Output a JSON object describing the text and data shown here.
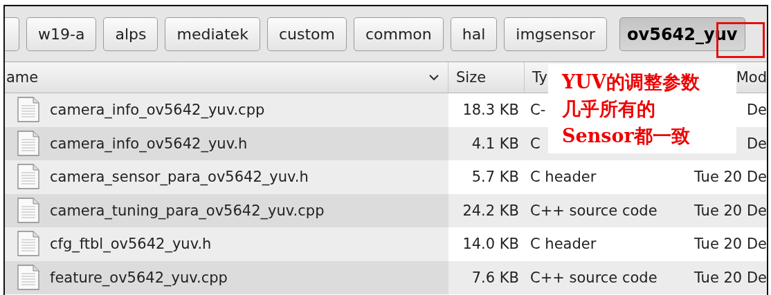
{
  "path_bar": {
    "buttons": [
      {
        "label": "w19-a",
        "selected": false
      },
      {
        "label": "alps",
        "selected": false
      },
      {
        "label": "mediatek",
        "selected": false
      },
      {
        "label": "custom",
        "selected": false
      },
      {
        "label": "common",
        "selected": false
      },
      {
        "label": "hal",
        "selected": false
      },
      {
        "label": "imgsensor",
        "selected": false
      },
      {
        "label": "ov5642_yuv",
        "selected": true
      }
    ]
  },
  "file_list": {
    "columns": [
      "ame",
      "Size",
      "Ty",
      "Mod"
    ],
    "rows": [
      {
        "name": "camera_info_ov5642_yuv.cpp",
        "size": "18.3 KB",
        "type": "C-",
        "modified": "De"
      },
      {
        "name": "camera_info_ov5642_yuv.h",
        "size": "4.1 KB",
        "type": "C",
        "modified": "De"
      },
      {
        "name": "camera_sensor_para_ov5642_yuv.h",
        "size": "5.7 KB",
        "type": "C header",
        "modified": "Tue 20 De"
      },
      {
        "name": "camera_tuning_para_ov5642_yuv.cpp",
        "size": "24.2 KB",
        "type": "C++ source code",
        "modified": "Tue 20 De"
      },
      {
        "name": "cfg_ftbl_ov5642_yuv.h",
        "size": "14.0 KB",
        "type": "C header",
        "modified": "Tue 20 De"
      },
      {
        "name": "feature_ov5642_yuv.cpp",
        "size": "7.6 KB",
        "type": "C++ source code",
        "modified": "Tue 20 De"
      }
    ]
  },
  "annotation": {
    "lines": [
      "YUV的调整参数",
      "几乎所有的",
      "Sensor都一致"
    ]
  }
}
